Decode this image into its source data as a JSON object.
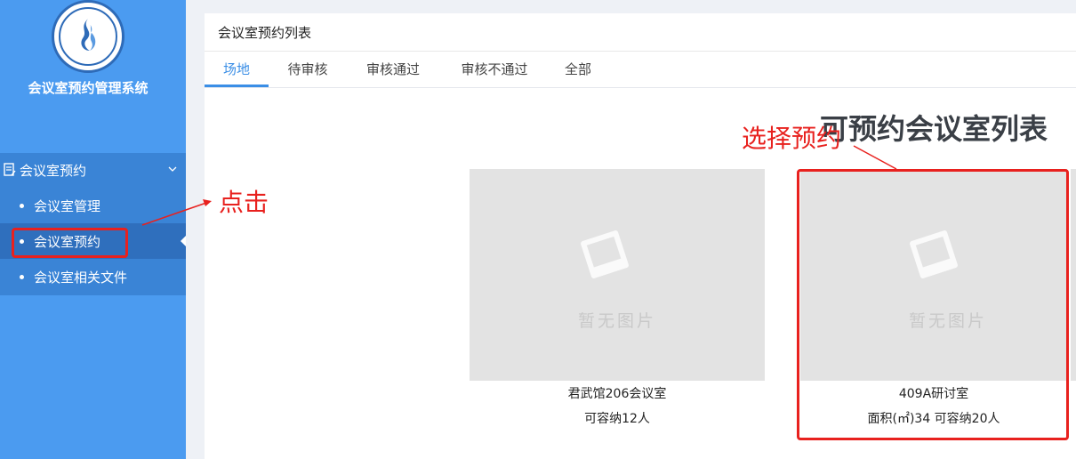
{
  "app": {
    "title": "会议室预约管理系统"
  },
  "sidebar": {
    "group_label": "会议室预约",
    "items": [
      {
        "label": "会议室管理"
      },
      {
        "label": "会议室预约",
        "active": true
      },
      {
        "label": "会议室相关文件"
      }
    ]
  },
  "panel": {
    "title": "会议室预约列表"
  },
  "tabs": [
    {
      "label": "场地",
      "active": true
    },
    {
      "label": "待审核"
    },
    {
      "label": "审核通过"
    },
    {
      "label": "审核不通过"
    },
    {
      "label": "全部"
    }
  ],
  "list_title": "可预约会议室列表",
  "placeholder_text": "暂无图片",
  "rooms": [
    {
      "name": "君武馆206会议室",
      "info": "可容纳12人"
    },
    {
      "name": "409A研讨室",
      "info": "面积(㎡)34 可容纳20人"
    }
  ],
  "annotations": {
    "click": "点击",
    "select": "选择预约"
  },
  "colors": {
    "sidebar": "#4b9bf0",
    "accent": "#3a8ee6",
    "annotation": "#e8211e"
  }
}
